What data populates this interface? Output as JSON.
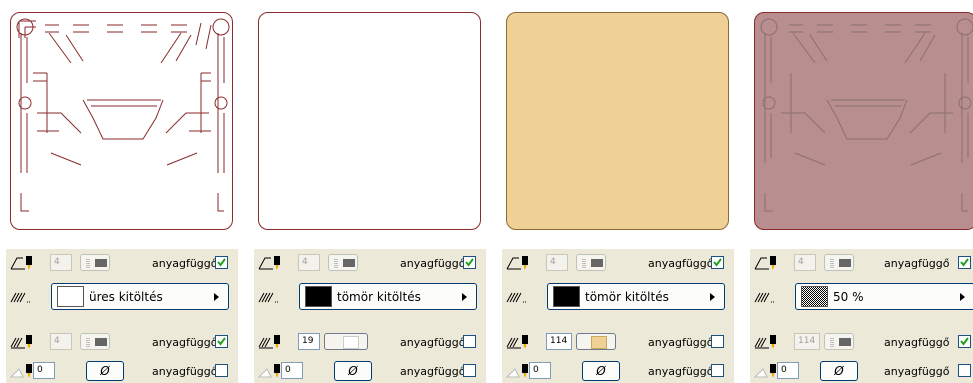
{
  "colors": {
    "panel_bg": "#ece9d8",
    "preview_outline": "#8a2a2a",
    "cream_fill": "#f0d195",
    "rose_fill": "#b98e8e",
    "check_green": "#21a121"
  },
  "columns": [
    {
      "preview": "outline-drawing",
      "row1": {
        "pen_value": "4",
        "pen_enabled": false,
        "label": "anyagfüggő",
        "checked": true
      },
      "fill": {
        "swatch": "empty",
        "label": "üres kitöltés"
      },
      "row3": {
        "pen_value": "4",
        "pen_enabled": false,
        "control": "pattern",
        "label": "anyagfüggő",
        "checked": true
      },
      "row4": {
        "value": "0",
        "button": "Ø",
        "label": "anyagfüggő",
        "checked": false
      }
    },
    {
      "preview": "blank-white",
      "row1": {
        "pen_value": "4",
        "pen_enabled": false,
        "label": "anyagfüggő",
        "checked": true
      },
      "fill": {
        "swatch": "black",
        "label": "tömör kitöltés"
      },
      "row3": {
        "pen_value": "19",
        "pen_enabled": true,
        "control": "color",
        "swatch_color": "#ffffff",
        "label": "anyagfüggő",
        "checked": false
      },
      "row4": {
        "value": "0",
        "button": "Ø",
        "label": "anyagfüggő",
        "checked": false
      }
    },
    {
      "preview": "solid-cream",
      "row1": {
        "pen_value": "4",
        "pen_enabled": false,
        "label": "anyagfüggő",
        "checked": true
      },
      "fill": {
        "swatch": "black",
        "label": "tömör kitöltés"
      },
      "row3": {
        "pen_value": "114",
        "pen_enabled": true,
        "control": "color",
        "swatch_color": "#f0d195",
        "label": "anyagfüggő",
        "checked": false
      },
      "row4": {
        "value": "0",
        "button": "Ø",
        "label": "anyagfüggő",
        "checked": false
      }
    },
    {
      "preview": "rose-with-outline",
      "row1": {
        "pen_value": "4",
        "pen_enabled": false,
        "label": "anyagfüggő",
        "checked": true
      },
      "fill": {
        "swatch": "halftone",
        "label": "50 %"
      },
      "row3": {
        "pen_value": "114",
        "pen_enabled": false,
        "control": "pattern",
        "label": "anyagfüggő",
        "checked": true
      },
      "row4": {
        "value": "0",
        "button": "Ø",
        "label": "anyagfüggő",
        "checked": false
      }
    }
  ]
}
